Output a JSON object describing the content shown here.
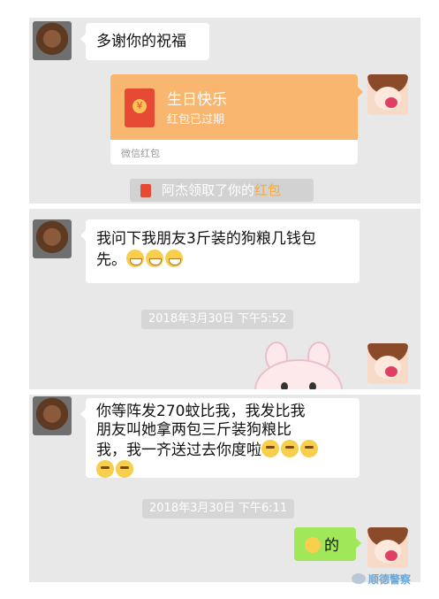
{
  "panel1": {
    "message": "多谢你的祝福",
    "red_packet": {
      "title": "生日快乐",
      "status": "红包已过期",
      "footer": "微信红包",
      "coin_symbol": "¥"
    },
    "system": {
      "prefix": "阿杰领取了你的",
      "link": "红包"
    }
  },
  "panel2": {
    "message_line1": "我问下我朋友3斤装的狗粮几钱包",
    "message_line2": "先。",
    "timestamp": "2018年3月30日 下午5:52"
  },
  "panel3": {
    "message_line1": "你等阵发270蚊比我，我发比我",
    "message_line2": "朋友叫她拿两包三斤装狗粮比",
    "message_line3": "我，我一齐送过去你度啦",
    "timestamp": "2018年3月30日 下午6:11",
    "reply": "的"
  },
  "watermark": "顺德警察",
  "colors": {
    "chat_bg": "#e8e8e8",
    "red_packet": "#f9b66f",
    "sent_bubble": "#a0e75a",
    "link": "#f9a93e"
  }
}
